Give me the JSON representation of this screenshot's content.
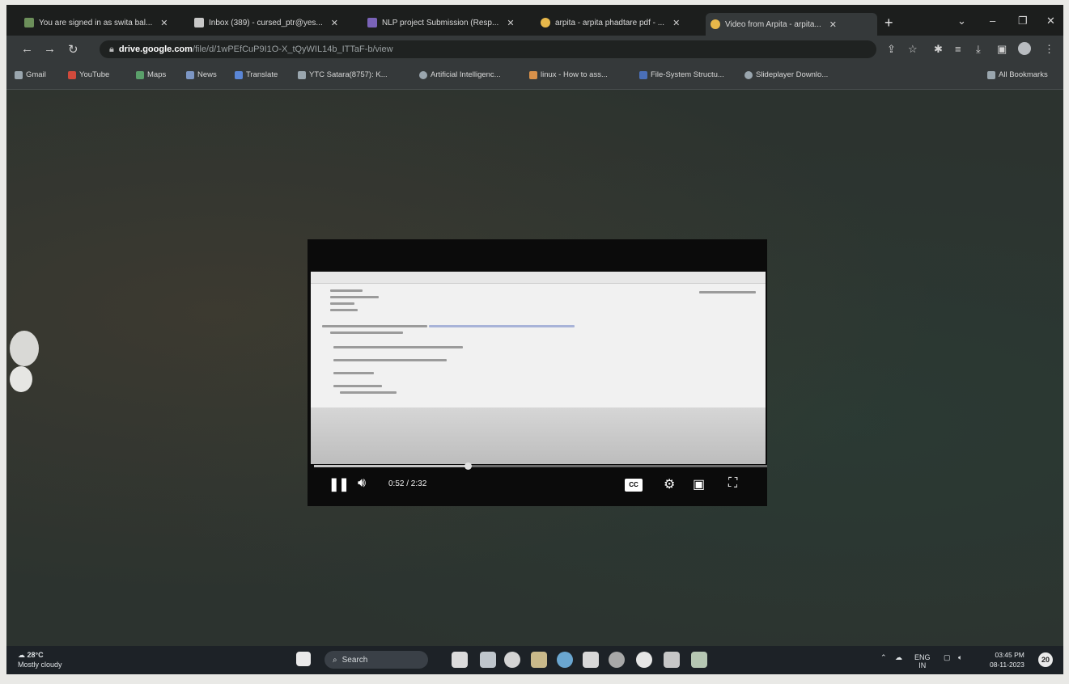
{
  "browser": {
    "tabs": [
      {
        "title": "You are signed in as swita bal...",
        "favicon": "classroom",
        "active": false
      },
      {
        "title": "Inbox (389) - cursed_ptr@yes...",
        "favicon": "gmail",
        "active": false
      },
      {
        "title": "NLP project Submission (Resp...",
        "favicon": "forms",
        "active": false
      },
      {
        "title": "arpita - arpita phadtare pdf - ...",
        "favicon": "drive",
        "active": false
      },
      {
        "title": "Video from Arpita - arpita...",
        "favicon": "drive",
        "active": true
      }
    ],
    "new_tab": "+",
    "url": {
      "host": "drive.google.com",
      "path": "/file/d/1wPEfCuP9I1O-X_tQyWIL14b_ITTaF-b/view"
    },
    "bookmarks": [
      {
        "label": "Gmail",
        "icon": "gmail-icon"
      },
      {
        "label": "YouTube",
        "icon": "youtube-icon"
      },
      {
        "label": "Maps",
        "icon": "maps-icon"
      },
      {
        "label": "News",
        "icon": "news-icon"
      },
      {
        "label": "Translate",
        "icon": "translate-icon"
      },
      {
        "label": "YTC Satara(8757): K...",
        "icon": "gmail-icon"
      },
      {
        "label": "Artificial Intelligenc...",
        "icon": "ai-icon"
      },
      {
        "label": "linux - How to ass...",
        "icon": "stack-icon"
      },
      {
        "label": "File-System Structu...",
        "icon": "doc-icon"
      },
      {
        "label": "Slideplayer Downlo...",
        "icon": "globe-icon"
      }
    ],
    "all_bookmarks": "All Bookmarks"
  },
  "video": {
    "time": "0:52 / 2:32",
    "progress": 0.34,
    "cc_label": "CC"
  },
  "taskbar": {
    "weather_temp": "28°C",
    "weather_desc": "Mostly cloudy",
    "search_label": "Search",
    "lang_top": "ENG",
    "lang_bottom": "IN",
    "time": "03:45 PM",
    "date": "08-11-2023",
    "notifications": "20"
  }
}
